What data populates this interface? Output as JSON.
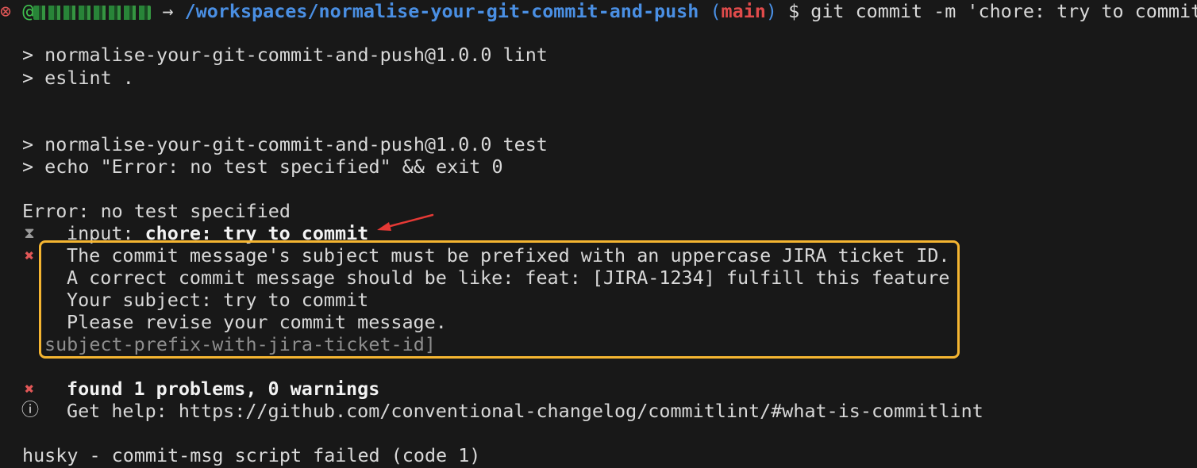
{
  "prompt": {
    "status_icon": "⊗",
    "at_sign": "@",
    "arrow": "→",
    "path": "/workspaces/normalise-your-git-commit-and-push",
    "paren_open": "(",
    "branch": "main",
    "paren_close": ")",
    "dollar": "$",
    "command": "git commit -m 'chore: try to commit'"
  },
  "lint": {
    "line1": "> normalise-your-git-commit-and-push@1.0.0 lint",
    "line2": "> eslint ."
  },
  "test": {
    "line1": "> normalise-your-git-commit-and-push@1.0.0 test",
    "line2": "> echo \"Error: no test specified\" && exit 0"
  },
  "error_line": "Error: no test specified",
  "commitlint": {
    "input_icon": "⧗",
    "input_label": "input:",
    "input_value": "chore: try to commit",
    "error_icon": "✖",
    "messages": [
      "The commit message's subject must be prefixed with an uppercase JIRA ticket ID.",
      "A correct commit message should be like: feat: [JIRA-1234] fulfill this feature",
      "Your subject: try to commit",
      "Please revise your commit message."
    ],
    "rule": "subject-prefix-with-jira-ticket-id]",
    "summary_icon": "✖",
    "summary": "found 1 problems, 0 warnings",
    "help_icon": "ⓘ",
    "help_label": "Get help:",
    "help_url": "https://github.com/conventional-changelog/commitlint/#what-is-commitlint"
  },
  "husky_line": "husky - commit-msg script failed (code 1)",
  "colors": {
    "background": "#181818",
    "highlight_border": "#f5b531",
    "annotation_arrow": "#e53935",
    "path": "#4a8fe3",
    "branch": "#e04b4b",
    "error": "#e15757"
  }
}
